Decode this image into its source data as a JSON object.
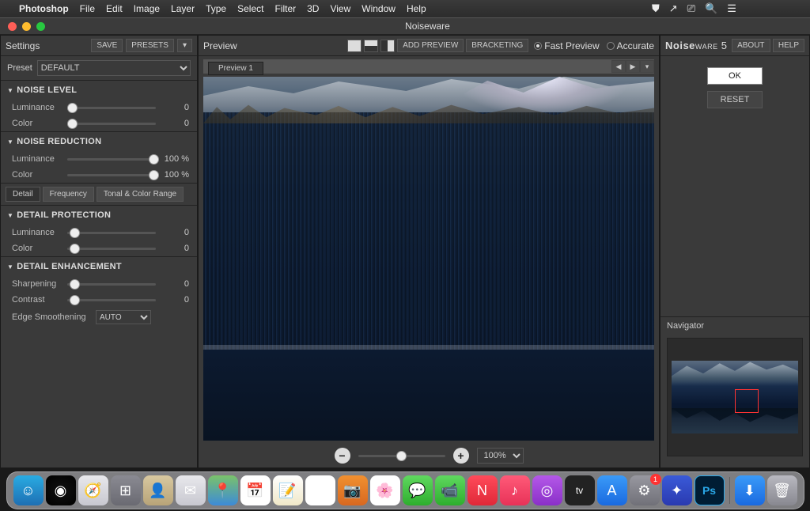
{
  "menubar": {
    "app": "Photoshop",
    "items": [
      "File",
      "Edit",
      "Image",
      "Layer",
      "Type",
      "Select",
      "Filter",
      "3D",
      "View",
      "Window",
      "Help"
    ]
  },
  "window": {
    "title": "Noiseware"
  },
  "settings": {
    "title": "Settings",
    "save": "SAVE",
    "presets": "PRESETS",
    "preset_label": "Preset",
    "preset_value": "DEFAULT",
    "noise_level": {
      "title": "NOISE LEVEL",
      "luminance": {
        "label": "Luminance",
        "value": "0",
        "pos": 46
      },
      "color": {
        "label": "Color",
        "value": "0",
        "pos": 46
      }
    },
    "noise_reduction": {
      "title": "NOISE REDUCTION",
      "luminance": {
        "label": "Luminance",
        "value": "100",
        "unit": "%",
        "pos": 92
      },
      "color": {
        "label": "Color",
        "value": "100",
        "unit": "%",
        "pos": 92
      }
    },
    "tabs": {
      "detail": "Detail",
      "frequency": "Frequency",
      "tonal": "Tonal & Color Range"
    },
    "detail_protection": {
      "title": "DETAIL PROTECTION",
      "luminance": {
        "label": "Luminance",
        "value": "0",
        "pos": 3
      },
      "color": {
        "label": "Color",
        "value": "0",
        "pos": 3
      }
    },
    "detail_enhancement": {
      "title": "DETAIL ENHANCEMENT",
      "sharpening": {
        "label": "Sharpening",
        "value": "0",
        "pos": 3
      },
      "contrast": {
        "label": "Contrast",
        "value": "0",
        "pos": 3
      },
      "edge_label": "Edge Smoothening",
      "edge_value": "AUTO"
    }
  },
  "preview": {
    "title": "Preview",
    "add": "ADD PREVIEW",
    "bracketing": "BRACKETING",
    "fast": "Fast Preview",
    "accurate": "Accurate",
    "tab": "Preview 1",
    "zoom": "100%"
  },
  "right": {
    "brand_a": "Noise",
    "brand_b": "ware",
    "ver": "5",
    "about": "ABOUT",
    "help": "HELP",
    "ok": "OK",
    "reset": "RESET",
    "navigator": "Navigator"
  },
  "dock": {
    "badge": "1",
    "icons": [
      {
        "n": "finder",
        "bg": "linear-gradient(#29abe2,#1e6fb3)",
        "g": "☺"
      },
      {
        "n": "siri",
        "bg": "radial-gradient(circle,#111,#000)",
        "g": "◉"
      },
      {
        "n": "safari",
        "bg": "linear-gradient(#e8e8ec,#c8c8d0)",
        "g": "🧭"
      },
      {
        "n": "launchpad",
        "bg": "linear-gradient(#8a8a92,#6a6a72)",
        "g": "⊞"
      },
      {
        "n": "contacts",
        "bg": "linear-gradient(#d8c8a0,#b8a478)",
        "g": "👤"
      },
      {
        "n": "mail",
        "bg": "linear-gradient(#e8e8ec,#c8c8d0)",
        "g": "✉"
      },
      {
        "n": "maps",
        "bg": "linear-gradient(#7ac26a,#3d8bd8)",
        "g": "📍"
      },
      {
        "n": "calendar",
        "bg": "#fff",
        "g": "📅"
      },
      {
        "n": "notes",
        "bg": "linear-gradient(#fff,#f0e8c8)",
        "g": "📝"
      },
      {
        "n": "reminders",
        "bg": "#fff",
        "g": "☑"
      },
      {
        "n": "photobooth",
        "bg": "linear-gradient(#f09030,#d86820)",
        "g": "📷"
      },
      {
        "n": "photos",
        "bg": "#fff",
        "g": "🌸"
      },
      {
        "n": "messages",
        "bg": "linear-gradient(#5fd85f,#2eae2e)",
        "g": "💬"
      },
      {
        "n": "facetime",
        "bg": "linear-gradient(#5fd85f,#2eae2e)",
        "g": "📹"
      },
      {
        "n": "news",
        "bg": "linear-gradient(#ff4a5a,#e02838)",
        "g": "N"
      },
      {
        "n": "music",
        "bg": "linear-gradient(#ff5a78,#e83258)",
        "g": "♪"
      },
      {
        "n": "podcasts",
        "bg": "linear-gradient(#b458e8,#8a30c8)",
        "g": "◎"
      },
      {
        "n": "tv",
        "bg": "#222",
        "g": "tv"
      },
      {
        "n": "appstore",
        "bg": "linear-gradient(#3a9af8,#1a6ae0)",
        "g": "A"
      },
      {
        "n": "preferences",
        "bg": "linear-gradient(#9898a0,#707078)",
        "g": "⚙",
        "badge": true
      },
      {
        "n": "aol",
        "bg": "linear-gradient(#3a5ad8,#2a3ab0)",
        "g": "✦"
      },
      {
        "n": "photoshop",
        "bg": "#001d34",
        "g": "Ps"
      }
    ],
    "right_icons": [
      {
        "n": "downloads",
        "bg": "linear-gradient(#3a9af8,#1a6ae0)",
        "g": "⬇"
      },
      {
        "n": "trash",
        "bg": "linear-gradient(#b8b8c0,#888890)",
        "g": "🗑"
      }
    ]
  }
}
